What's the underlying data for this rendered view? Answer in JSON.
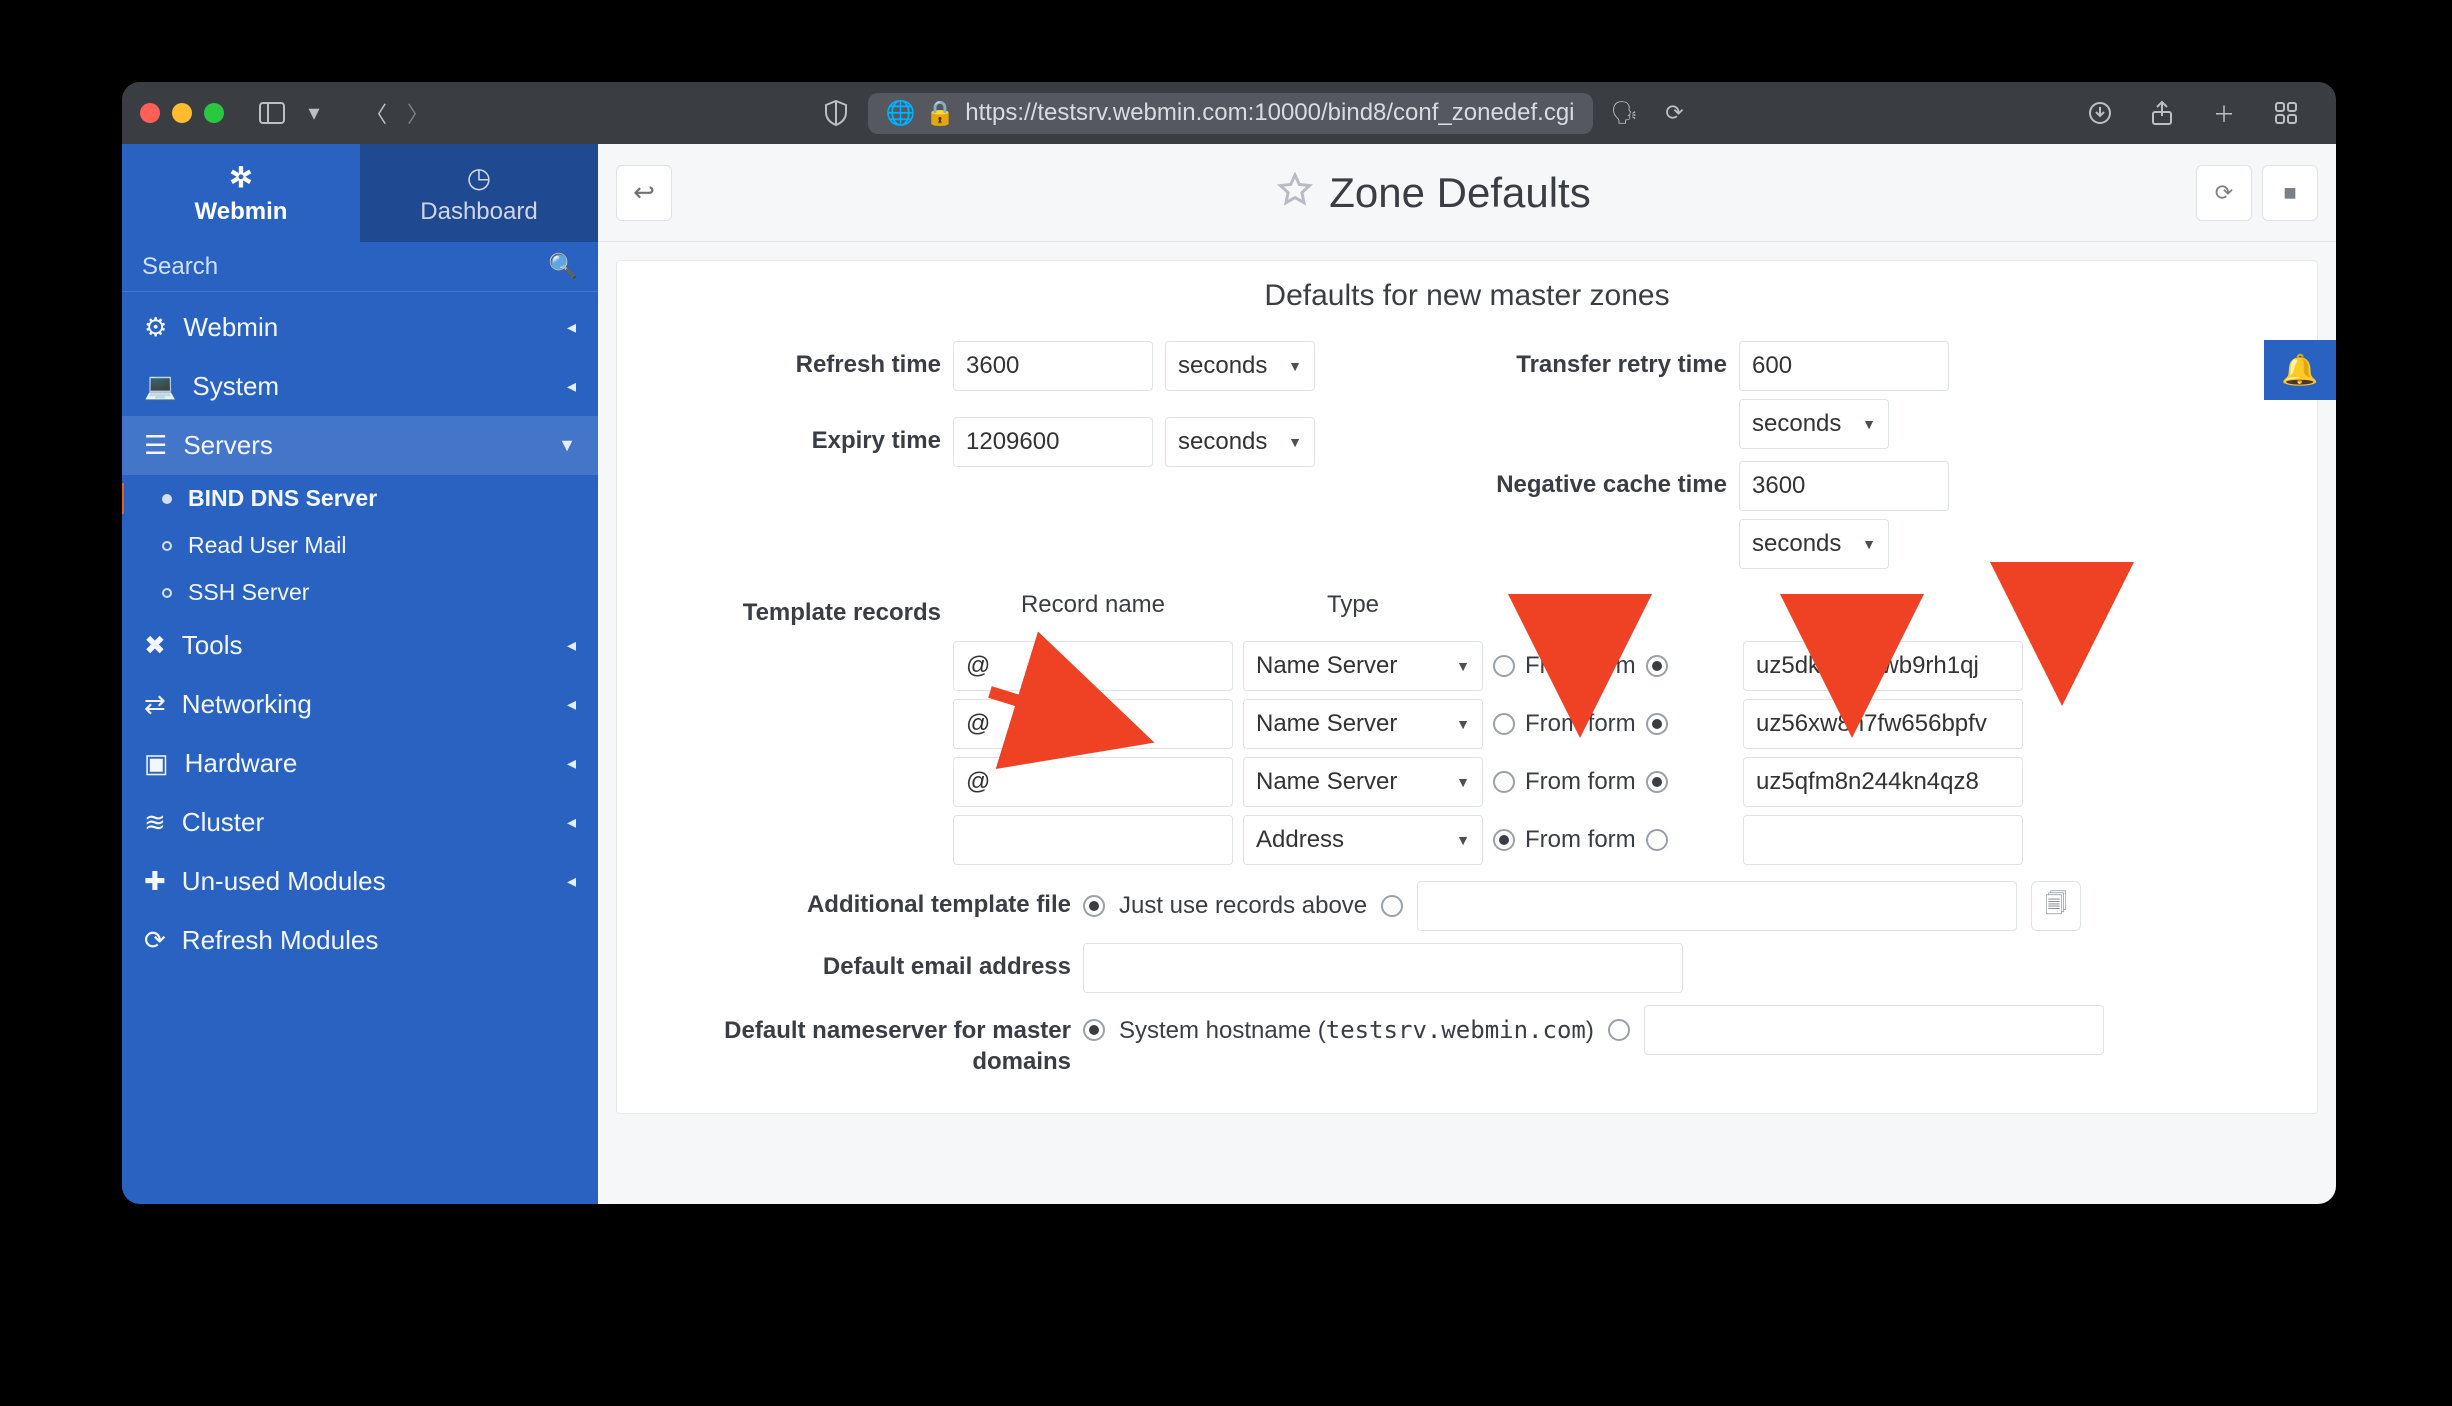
{
  "browser": {
    "url_display": "https://testsrv.webmin.com:10000/bind8/conf_zonedef.cgi"
  },
  "sidebar": {
    "tabs": {
      "active": "Webmin",
      "inactive": "Dashboard"
    },
    "search_placeholder": "Search",
    "items": [
      {
        "label": "Webmin",
        "icon": "⚙",
        "open": false
      },
      {
        "label": "System",
        "icon": "💻",
        "open": false
      },
      {
        "label": "Servers",
        "icon": "☰",
        "open": true,
        "children": [
          {
            "label": "BIND DNS Server",
            "active": true
          },
          {
            "label": "Read User Mail",
            "active": false
          },
          {
            "label": "SSH Server",
            "active": false
          }
        ]
      },
      {
        "label": "Tools",
        "icon": "✖",
        "open": false
      },
      {
        "label": "Networking",
        "icon": "⇄",
        "open": false
      },
      {
        "label": "Hardware",
        "icon": "▣",
        "open": false
      },
      {
        "label": "Cluster",
        "icon": "≋",
        "open": false
      },
      {
        "label": "Un-used Modules",
        "icon": "✚",
        "open": false
      },
      {
        "label": "Refresh Modules",
        "icon": "⟳",
        "open": false
      }
    ]
  },
  "header": {
    "title": "Zone Defaults"
  },
  "panel": {
    "title": "Defaults for new master zones",
    "refresh_label": "Refresh time",
    "refresh_value": "3600",
    "refresh_unit": "seconds",
    "transfer_label": "Transfer retry time",
    "transfer_value": "600",
    "transfer_unit": "seconds",
    "expiry_label": "Expiry time",
    "expiry_value": "1209600",
    "expiry_unit": "seconds",
    "negcache_label": "Negative cache time",
    "negcache_value": "3600",
    "negcache_unit": "seconds",
    "template_label": "Template records",
    "headers": {
      "name": "Record name",
      "type": "Type",
      "value": "Value"
    },
    "from_form": "From form",
    "records": [
      {
        "name": "@",
        "type": "Name Server",
        "from_form_left": false,
        "from_form_right": true,
        "value": "uz5dkwpjfvfwb9rh1qj"
      },
      {
        "name": "@",
        "type": "Name Server",
        "from_form_left": false,
        "from_form_right": true,
        "value": "uz56xw8h7fw656bpfv"
      },
      {
        "name": "@",
        "type": "Name Server",
        "from_form_left": false,
        "from_form_right": true,
        "value": "uz5qfm8n244kn4qz8"
      },
      {
        "name": "",
        "type": "Address",
        "from_form_left": true,
        "from_form_right": false,
        "value": ""
      }
    ],
    "add_tpl_label": "Additional template file",
    "add_tpl_option": "Just use records above",
    "email_label": "Default email address",
    "ns_label": "Default nameserver for master domains",
    "ns_option_prefix": "System hostname (",
    "ns_option_host": "testsrv.webmin.com",
    "ns_option_suffix": ")"
  }
}
